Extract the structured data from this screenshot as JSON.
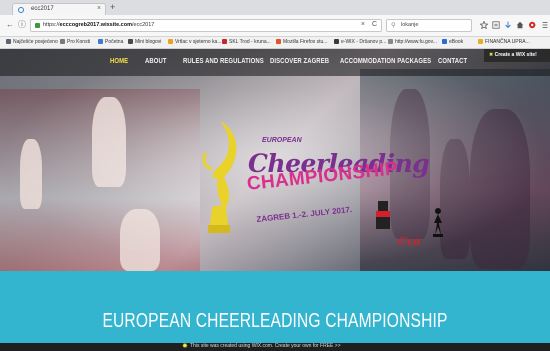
{
  "browser": {
    "tab_title": "ecc2017",
    "tab_close": "×",
    "new_tab": "+",
    "back": "←",
    "info": "ⓘ",
    "address_prefix": "https://",
    "address_domain": "ecccogreb2017.wixsite.com",
    "address_path": "/ecc2017",
    "address_clear": "×",
    "address_go": "C",
    "search_glyph": "⚲",
    "search_text": "lokanje"
  },
  "bookmarks": [
    {
      "label": "Najčešće posjećeno",
      "color": "#5b6470"
    },
    {
      "label": "Pro Konsti",
      "color": "#7a7a7a"
    },
    {
      "label": "Početna",
      "color": "#3a7bd5"
    },
    {
      "label": "Mini blogovi",
      "color": "#4a4a4a"
    },
    {
      "label": "Vrtlac v sjeterno ka...",
      "color": "#f0a020"
    },
    {
      "label": "SKL Trod - kruna...",
      "color": "#c02a2a"
    },
    {
      "label": "Mozilla Firefox stu...",
      "color": "#e0542a"
    },
    {
      "label": "e-WIX - Dršanov p...",
      "color": "#3a3a3a"
    },
    {
      "label": "http://www.fu.gov...",
      "color": "#888888"
    },
    {
      "label": "eBook",
      "color": "#2a6bd0"
    },
    {
      "label": "FINANČNA UPRA...",
      "color": "#e0b020"
    }
  ],
  "nav": {
    "items": [
      "HOME",
      "ABOUT",
      "RULES AND REGULATIONS",
      "DISCOVER ZAGREB",
      "ACCOMMODATION PACKAGES",
      "CONTACT"
    ],
    "active_color": "#f4e14a"
  },
  "wix_badge": {
    "mark": "✖",
    "text": "Create a WIX site!"
  },
  "logo": {
    "european": "EUROPEAN",
    "cheer": "Cheerleading",
    "champ": "CHAMPIONSHIP",
    "date": "ZAGREB 1.-2. JULY 2017."
  },
  "sponsor": {
    "cca": "Cca"
  },
  "banner": {
    "title": "EUROPEAN CHEERLEADING CHAMPIONSHIP",
    "color": "#33b4cf"
  },
  "footer": {
    "star": "✸",
    "text": "This site was created using WIX.com. Create your own for FREE >>"
  }
}
